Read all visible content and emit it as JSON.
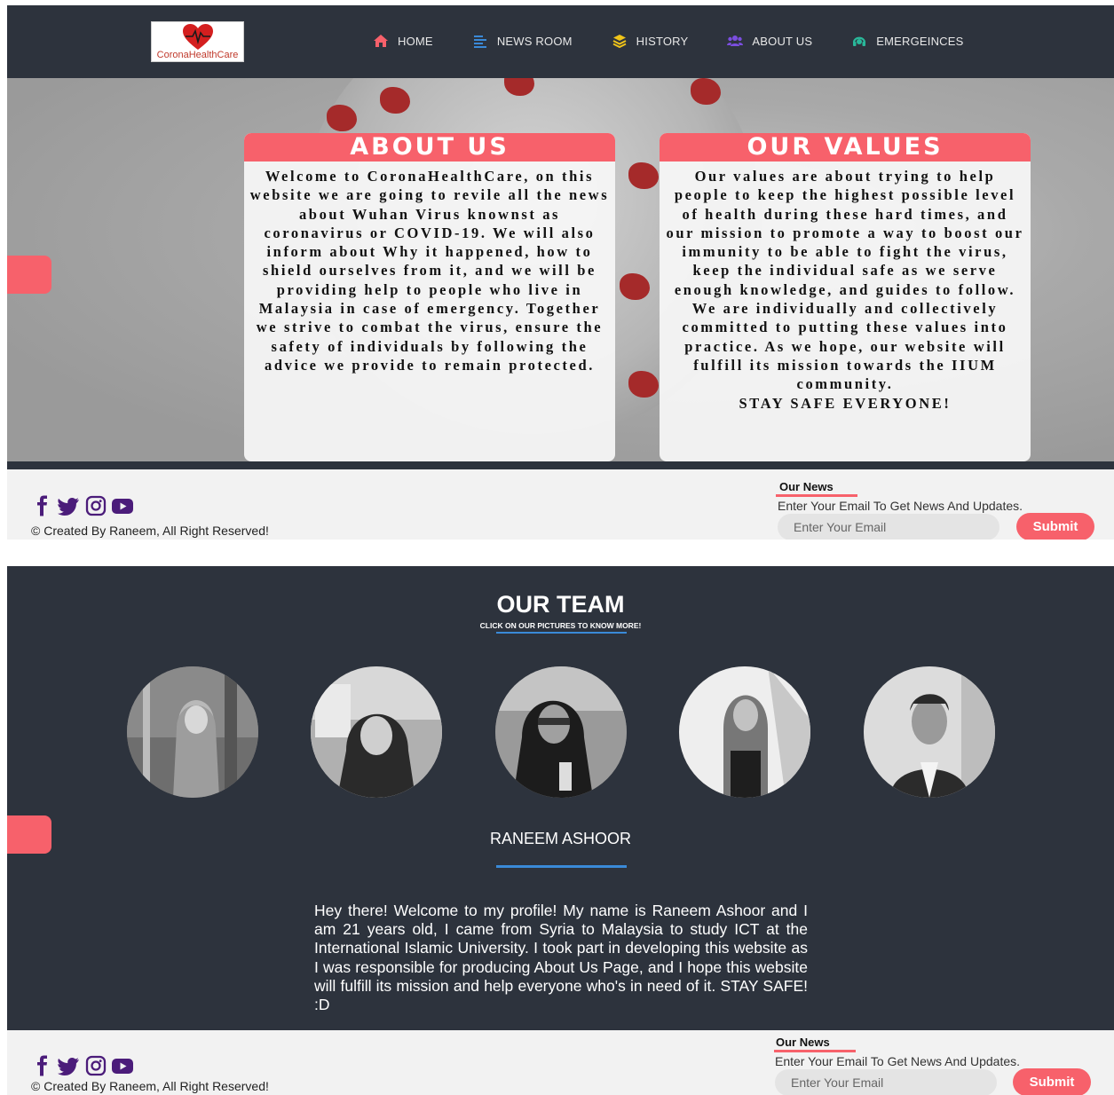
{
  "brand": {
    "logo_text": "CoronaHealthCare"
  },
  "nav": {
    "items": [
      {
        "label": "HOME",
        "icon": "home-icon"
      },
      {
        "label": "NEWS ROOM",
        "icon": "news-icon"
      },
      {
        "label": "HISTORY",
        "icon": "layers-icon"
      },
      {
        "label": "ABOUT US",
        "icon": "users-icon"
      },
      {
        "label": "EMERGEINCES",
        "icon": "headset-icon"
      }
    ]
  },
  "about": {
    "title": "ABOUT US",
    "body": "Welcome to CoronaHealthCare, on this website we are going to revile all the news about Wuhan Virus knownst as coronavirus or COVID-19. We will also inform about Why it happened, how to shield ourselves from it, and we will be providing help to people who live in Malaysia in case of emergency. Together we strive to combat the virus, ensure the safety of individuals by following the advice we provide to remain protected."
  },
  "values": {
    "title": "OUR VALUES",
    "body": "Our values are about trying to help people to keep the highest possible level of health during these hard times, and our mission to promote a way to boost our immunity to be able to fight the virus, keep the individual safe as we serve enough knowledge, and guides to follow. We are individually and collectively committed to putting these values into practice. As we hope, our website will fulfill its mission towards the IIUM community.",
    "closing": "STAY SAFE EVERYONE!"
  },
  "footer": {
    "copyright": "© Created By Raneem, All Right Reserved!",
    "news_title": "Our News",
    "news_desc": "Enter Your Email To Get News And Updates.",
    "email_placeholder": "Enter Your Email",
    "submit_label": "Submit",
    "social_icons": [
      "facebook-icon",
      "twitter-icon",
      "instagram-icon",
      "youtube-icon"
    ]
  },
  "team": {
    "title": "OUR TEAM",
    "subtitle": "CLICK ON OUR PICTURES TO KNOW MORE!",
    "member_name": "RANEEM ASHOOR",
    "bio": "Hey there! Welcome to my profile! My name is Raneem Ashoor and I am 21 years old, I came from Syria to Malaysia to study ICT at the International Islamic University. I took part in developing this website as I was responsible for producing About Us Page, and I hope this website will fulfill its mission and help everyone who's in need of it. STAY SAFE! :D"
  },
  "colors": {
    "accent": "#f7616b",
    "dark": "#2d333d",
    "blue_underline": "#3a8ad8",
    "social_purple": "#4b1c7a"
  }
}
